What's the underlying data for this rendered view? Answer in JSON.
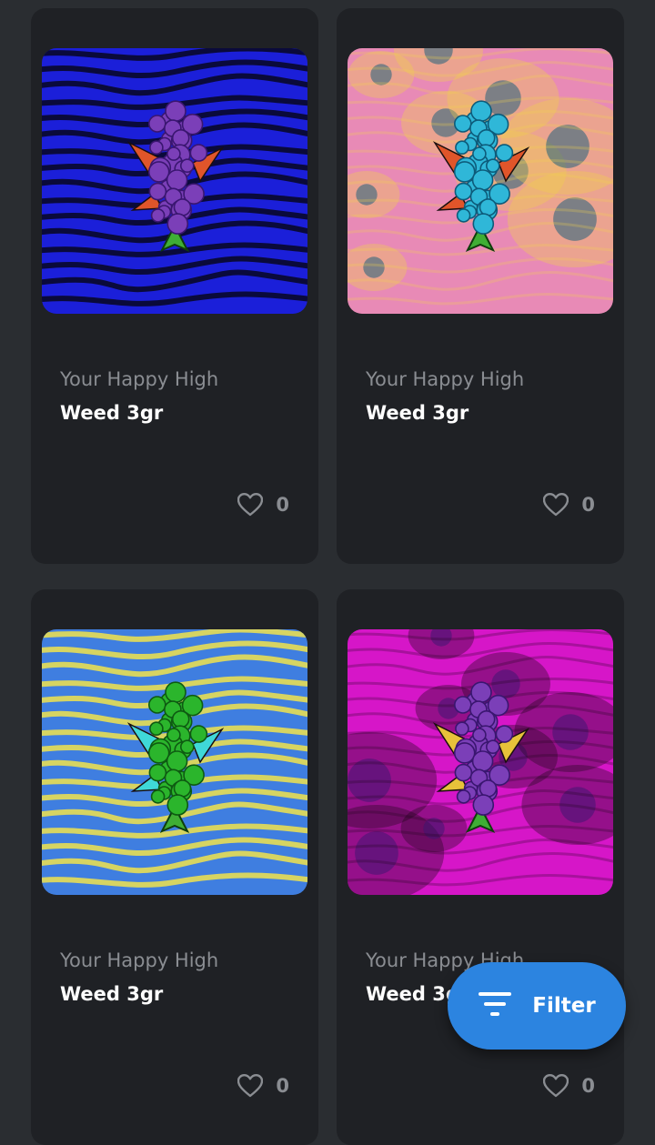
{
  "products": [
    {
      "creator": "Your Happy High",
      "title": "Weed 3gr",
      "likes": "0",
      "art": {
        "background": "#1b1fd9",
        "pattern": "#07071f",
        "bud": "#7b3fb8",
        "bud_dark": "#3a1670",
        "leaf": "#e0552a"
      }
    },
    {
      "creator": "Your Happy High",
      "title": "Weed 3gr",
      "likes": "0",
      "art": {
        "background": "#e88ab6",
        "pattern": "#f2d24a",
        "bud": "#2fb7d8",
        "bud_dark": "#0d5b7a",
        "leaf": "#e0552a"
      }
    },
    {
      "creator": "Your Happy High",
      "title": "Weed 3gr",
      "likes": "0",
      "art": {
        "background": "#3f7ee0",
        "pattern": "#f1e34b",
        "bud": "#2bb52c",
        "bud_dark": "#0e5a12",
        "leaf": "#3fd8d8"
      }
    },
    {
      "creator": "Your Happy High",
      "title": "Weed 3gr",
      "likes": "0",
      "art": {
        "background": "#d616c8",
        "pattern": "#1d0518",
        "bud": "#7b3fb8",
        "bud_dark": "#3a1670",
        "leaf": "#e7c23a"
      }
    }
  ],
  "filter": {
    "label": "Filter",
    "icon": "filter-icon"
  },
  "colors": {
    "page_background": "#2a2d31",
    "card_background": "#1f2125",
    "accent": "#2c84e0",
    "muted_text": "#8a8d92"
  }
}
